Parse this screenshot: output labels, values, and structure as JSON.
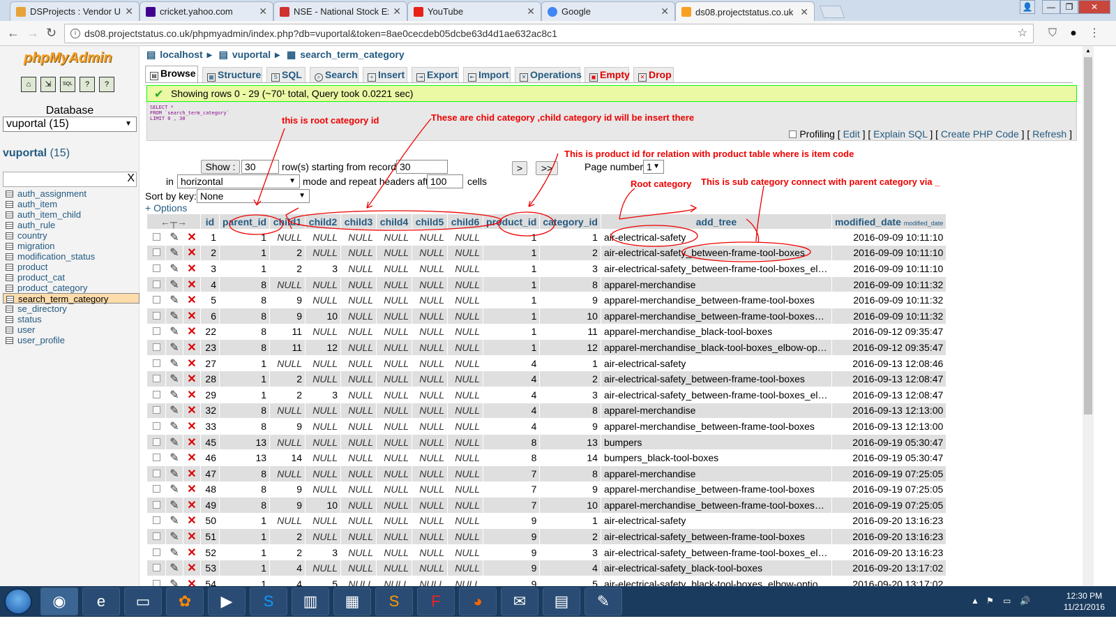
{
  "browser": {
    "tabs": [
      {
        "title": "DSProjects : Vendor Uplo",
        "color": "#e8a23a"
      },
      {
        "title": "cricket.yahoo.com",
        "color": "#400090"
      },
      {
        "title": "NSE - National Stock Exc",
        "color": "#d03030"
      },
      {
        "title": "YouTube",
        "color": "#e62117"
      },
      {
        "title": "Google",
        "color": "#4285f4"
      },
      {
        "title": "ds08.projectstatus.co.uk",
        "color": "#f8a024"
      }
    ],
    "url": "ds08.projectstatus.co.uk/phpmyadmin/index.php?db=vuportal&token=8ae0cecdeb05dcbe63d4d1ae632ac8c1"
  },
  "sidebar": {
    "logo": "phpMyAdmin",
    "database_label": "Database",
    "db_select": "vuportal (15)",
    "db_name": "vuportal",
    "db_count": "(15)",
    "filter_clear": "X",
    "tables": [
      "auth_assignment",
      "auth_item",
      "auth_item_child",
      "auth_rule",
      "country",
      "migration",
      "modification_status",
      "product",
      "product_cat",
      "product_category",
      "search_term_category",
      "se_directory",
      "status",
      "user",
      "user_profile"
    ],
    "selected": "search_term_category"
  },
  "breadcrumb": {
    "server": "localhost",
    "database": "vuportal",
    "table": "search_term_category"
  },
  "tabs": [
    "Browse",
    "Structure",
    "SQL",
    "Search",
    "Insert",
    "Export",
    "Import",
    "Operations",
    "Empty",
    "Drop"
  ],
  "success": "Showing rows 0 - 29 (~70¹ total, Query took 0.0221 sec)",
  "sql": "SELECT *\nFROM `search_term_category`\nLIMIT 0 , 30",
  "profiling": {
    "label": "Profiling",
    "edit": "Edit",
    "explain": "Explain SQL",
    "php": "Create PHP Code",
    "refresh": "Refresh"
  },
  "nav": {
    "show_btn": "Show :",
    "rows": "30",
    "rows_text": "row(s) starting from record #",
    "start": "30",
    "in": "in",
    "mode": "horizontal",
    "mode_text": "mode and repeat headers after",
    "repeat": "100",
    "cells": "cells",
    "next": ">",
    "last": ">>",
    "page_label": "Page number:",
    "page": "1",
    "sort_label": "Sort by key:",
    "sort": "None",
    "options": "+ Options"
  },
  "annotations": {
    "root_id": "this is root category id",
    "child": "These are chid category ,child category id will be insert there",
    "product": "This is product id for relation with product table where is item code",
    "root_cat": "Root category",
    "sub_cat": "This is sub category connect with parent category via _"
  },
  "table": {
    "columns": [
      "id",
      "parent_id",
      "child1",
      "child2",
      "child3",
      "child4",
      "child5",
      "child6",
      "product_id",
      "category_id",
      "add_tree",
      "modified_date"
    ],
    "modified_sub": "modified_date",
    "rows": [
      [
        "1",
        "1",
        "NULL",
        "NULL",
        "NULL",
        "NULL",
        "NULL",
        "NULL",
        "1",
        "1",
        "air-electrical-safety",
        "2016-09-09 10:11:10"
      ],
      [
        "2",
        "1",
        "2",
        "NULL",
        "NULL",
        "NULL",
        "NULL",
        "NULL",
        "1",
        "2",
        "air-electrical-safety_between-frame-tool-boxes",
        "2016-09-09 10:11:10"
      ],
      [
        "3",
        "1",
        "2",
        "3",
        "NULL",
        "NULL",
        "NULL",
        "NULL",
        "1",
        "3",
        "air-electrical-safety_between-frame-tool-boxes_elb...",
        "2016-09-09 10:11:10"
      ],
      [
        "4",
        "8",
        "NULL",
        "NULL",
        "NULL",
        "NULL",
        "NULL",
        "NULL",
        "1",
        "8",
        "apparel-merchandise",
        "2016-09-09 10:11:32"
      ],
      [
        "5",
        "8",
        "9",
        "NULL",
        "NULL",
        "NULL",
        "NULL",
        "NULL",
        "1",
        "9",
        "apparel-merchandise_between-frame-tool-boxes",
        "2016-09-09 10:11:32"
      ],
      [
        "6",
        "8",
        "9",
        "10",
        "NULL",
        "NULL",
        "NULL",
        "NULL",
        "1",
        "10",
        "apparel-merchandise_between-frame-tool-boxes_elbow...",
        "2016-09-09 10:11:32"
      ],
      [
        "22",
        "8",
        "11",
        "NULL",
        "NULL",
        "NULL",
        "NULL",
        "NULL",
        "1",
        "11",
        "apparel-merchandise_black-tool-boxes",
        "2016-09-12 09:35:47"
      ],
      [
        "23",
        "8",
        "11",
        "12",
        "NULL",
        "NULL",
        "NULL",
        "NULL",
        "1",
        "12",
        "apparel-merchandise_black-tool-boxes_elbow-options...",
        "2016-09-12 09:35:47"
      ],
      [
        "27",
        "1",
        "NULL",
        "NULL",
        "NULL",
        "NULL",
        "NULL",
        "NULL",
        "4",
        "1",
        "air-electrical-safety",
        "2016-09-13 12:08:46"
      ],
      [
        "28",
        "1",
        "2",
        "NULL",
        "NULL",
        "NULL",
        "NULL",
        "NULL",
        "4",
        "2",
        "air-electrical-safety_between-frame-tool-boxes",
        "2016-09-13 12:08:47"
      ],
      [
        "29",
        "1",
        "2",
        "3",
        "NULL",
        "NULL",
        "NULL",
        "NULL",
        "4",
        "3",
        "air-electrical-safety_between-frame-tool-boxes_elb...",
        "2016-09-13 12:08:47"
      ],
      [
        "32",
        "8",
        "NULL",
        "NULL",
        "NULL",
        "NULL",
        "NULL",
        "NULL",
        "4",
        "8",
        "apparel-merchandise",
        "2016-09-13 12:13:00"
      ],
      [
        "33",
        "8",
        "9",
        "NULL",
        "NULL",
        "NULL",
        "NULL",
        "NULL",
        "4",
        "9",
        "apparel-merchandise_between-frame-tool-boxes",
        "2016-09-13 12:13:00"
      ],
      [
        "45",
        "13",
        "NULL",
        "NULL",
        "NULL",
        "NULL",
        "NULL",
        "NULL",
        "8",
        "13",
        "bumpers",
        "2016-09-19 05:30:47"
      ],
      [
        "46",
        "13",
        "14",
        "NULL",
        "NULL",
        "NULL",
        "NULL",
        "NULL",
        "8",
        "14",
        "bumpers_black-tool-boxes",
        "2016-09-19 05:30:47"
      ],
      [
        "47",
        "8",
        "NULL",
        "NULL",
        "NULL",
        "NULL",
        "NULL",
        "NULL",
        "7",
        "8",
        "apparel-merchandise",
        "2016-09-19 07:25:05"
      ],
      [
        "48",
        "8",
        "9",
        "NULL",
        "NULL",
        "NULL",
        "NULL",
        "NULL",
        "7",
        "9",
        "apparel-merchandise_between-frame-tool-boxes",
        "2016-09-19 07:25:05"
      ],
      [
        "49",
        "8",
        "9",
        "10",
        "NULL",
        "NULL",
        "NULL",
        "NULL",
        "7",
        "10",
        "apparel-merchandise_between-frame-tool-boxes_elbow...",
        "2016-09-19 07:25:05"
      ],
      [
        "50",
        "1",
        "NULL",
        "NULL",
        "NULL",
        "NULL",
        "NULL",
        "NULL",
        "9",
        "1",
        "air-electrical-safety",
        "2016-09-20 13:16:23"
      ],
      [
        "51",
        "1",
        "2",
        "NULL",
        "NULL",
        "NULL",
        "NULL",
        "NULL",
        "9",
        "2",
        "air-electrical-safety_between-frame-tool-boxes",
        "2016-09-20 13:16:23"
      ],
      [
        "52",
        "1",
        "2",
        "3",
        "NULL",
        "NULL",
        "NULL",
        "NULL",
        "9",
        "3",
        "air-electrical-safety_between-frame-tool-boxes_elb...",
        "2016-09-20 13:16:23"
      ],
      [
        "53",
        "1",
        "4",
        "NULL",
        "NULL",
        "NULL",
        "NULL",
        "NULL",
        "9",
        "4",
        "air-electrical-safety_black-tool-boxes",
        "2016-09-20 13:17:02"
      ],
      [
        "54",
        "1",
        "4",
        "5",
        "NULL",
        "NULL",
        "NULL",
        "NULL",
        "9",
        "5",
        "air-electrical-safety_black-tool-boxes_elbow-optio...",
        "2016-09-20 13:17:02"
      ]
    ]
  },
  "taskbar": {
    "time": "12:30 PM",
    "date": "11/21/2016"
  }
}
